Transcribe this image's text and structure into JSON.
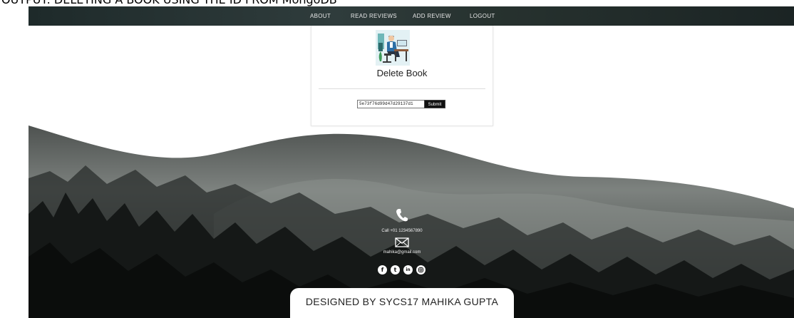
{
  "caption": "OUTPUT: DELETING A BOOK USING THE ID FROM MongoDB",
  "nav": {
    "items": [
      {
        "label": "ABOUT"
      },
      {
        "label": "READ REVIEWS"
      },
      {
        "label": "ADD REVIEW"
      },
      {
        "label": "LOGOUT"
      }
    ]
  },
  "card": {
    "title": "Delete Book",
    "id_value": "5e73f76d99d47d29137d1",
    "submit_label": "Submit"
  },
  "contact": {
    "call": "Call +01 1234567890",
    "email": "mahika@gmail.com",
    "social_icons": [
      "facebook-icon",
      "twitter-icon",
      "linkedin-icon",
      "instagram-icon"
    ]
  },
  "footer": {
    "credit": "DESIGNED BY SYCS17 MAHIKA GUPTA"
  },
  "colors": {
    "navbar": "#26312f",
    "footer_dark": "#1a1d1c",
    "card_bg": "#ffffff",
    "submit_bg": "#111111"
  }
}
